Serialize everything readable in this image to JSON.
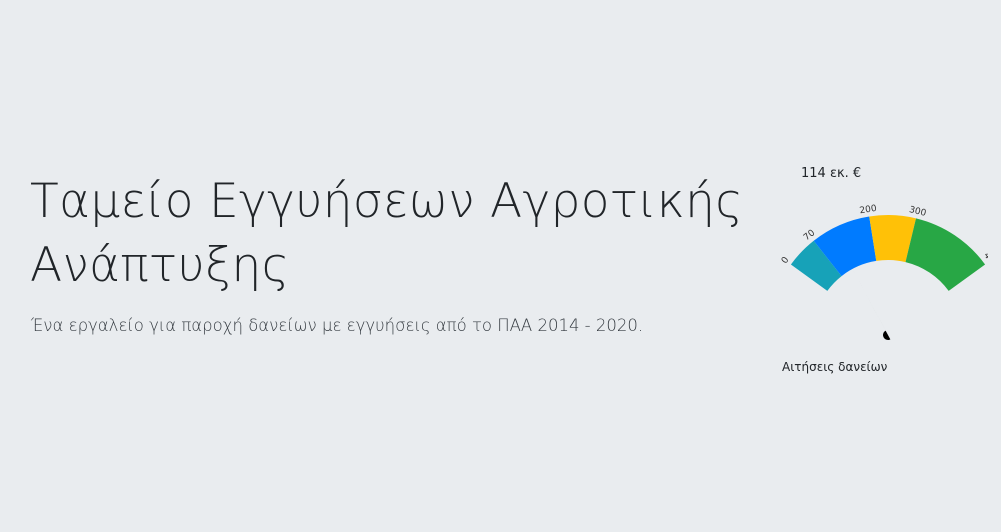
{
  "hero": {
    "title": "Ταμείο Εγγυήσεων Αγροτικής Ανάπτυξης",
    "lead": "Ένα εργαλείο για παροχή δανείων με εγγυήσεις από το ΠΑΑ 2014 - 2020."
  },
  "gauge": {
    "value_text": "114 εκ. €",
    "caption": "Αιτήσεις δανείων",
    "value": 114,
    "min": 0,
    "max": 480,
    "ticks": [
      "0",
      "70",
      "200",
      "300",
      "480"
    ],
    "bands": [
      {
        "from": 0,
        "to": 70,
        "color": "#17a2b8"
      },
      {
        "from": 70,
        "to": 200,
        "color": "#007bff"
      },
      {
        "from": 200,
        "to": 300,
        "color": "#ffc107"
      },
      {
        "from": 300,
        "to": 480,
        "color": "#28a745"
      }
    ],
    "needle_color": "#000000"
  }
}
